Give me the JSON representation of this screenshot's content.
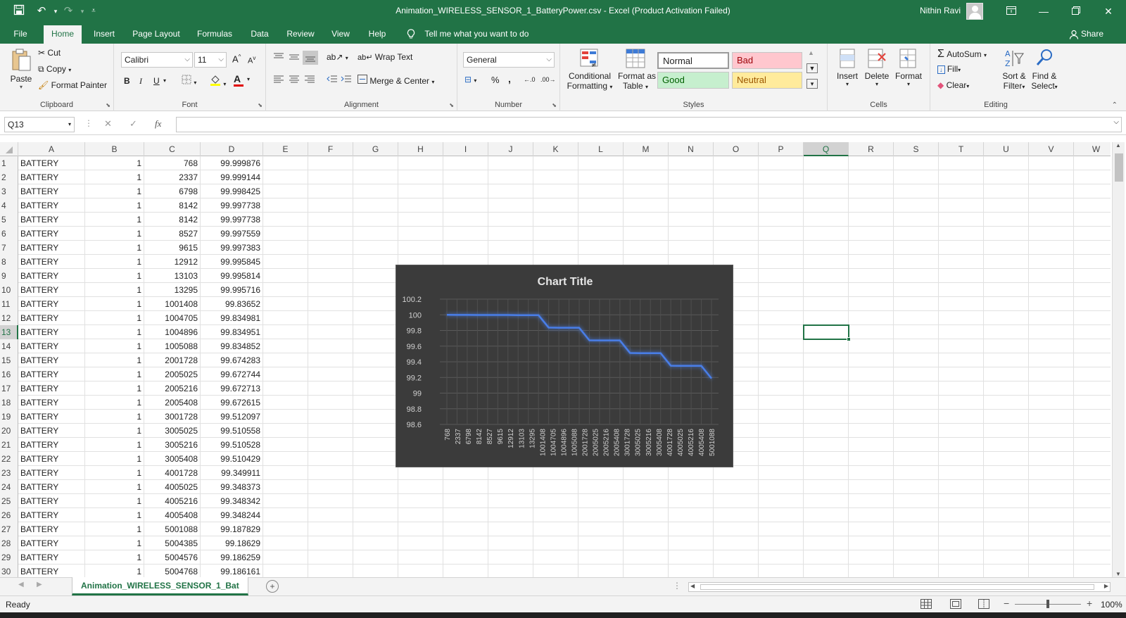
{
  "titlebar": {
    "title": "Animation_WIRELESS_SENSOR_1_BatteryPower.csv  -  Excel (Product Activation Failed)",
    "user": "Nithin Ravi"
  },
  "tabs": [
    "File",
    "Home",
    "Insert",
    "Page Layout",
    "Formulas",
    "Data",
    "Review",
    "View",
    "Help"
  ],
  "active_tab": "Home",
  "tell_me": "Tell me what you want to do",
  "share": "Share",
  "ribbon": {
    "clipboard": {
      "paste": "Paste",
      "cut": "Cut",
      "copy": "Copy",
      "format_painter": "Format Painter",
      "label": "Clipboard"
    },
    "font": {
      "name": "Calibri",
      "size": "11",
      "bold": "B",
      "italic": "I",
      "underline": "U",
      "label": "Font"
    },
    "alignment": {
      "wrap": "Wrap Text",
      "merge": "Merge & Center",
      "label": "Alignment"
    },
    "number": {
      "format": "General",
      "percent": "%",
      "comma": ",",
      "label": "Number"
    },
    "styles": {
      "conditional": [
        "Conditional",
        "Formatting"
      ],
      "format_table": [
        "Format as",
        "Table"
      ],
      "normal": "Normal",
      "bad": "Bad",
      "good": "Good",
      "neutral": "Neutral",
      "label": "Styles"
    },
    "cells": {
      "insert": "Insert",
      "delete": "Delete",
      "format": "Format",
      "label": "Cells"
    },
    "editing": {
      "autosum": "AutoSum",
      "fill": "Fill",
      "clear": "Clear",
      "sort": [
        "Sort &",
        "Filter"
      ],
      "find": [
        "Find &",
        "Select"
      ],
      "label": "Editing"
    }
  },
  "formula_bar": {
    "name_box": "Q13",
    "fx": "fx",
    "value": ""
  },
  "columns": [
    "A",
    "B",
    "C",
    "D",
    "E",
    "F",
    "G",
    "H",
    "I",
    "J",
    "K",
    "L",
    "M",
    "N",
    "O",
    "P",
    "Q",
    "R",
    "S",
    "T",
    "U",
    "V",
    "W"
  ],
  "selected_column": "Q",
  "selected_row": 13,
  "rows": [
    [
      "BATTERY",
      "1",
      "768",
      "99.999876"
    ],
    [
      "BATTERY",
      "1",
      "2337",
      "99.999144"
    ],
    [
      "BATTERY",
      "1",
      "6798",
      "99.998425"
    ],
    [
      "BATTERY",
      "1",
      "8142",
      "99.997738"
    ],
    [
      "BATTERY",
      "1",
      "8142",
      "99.997738"
    ],
    [
      "BATTERY",
      "1",
      "8527",
      "99.997559"
    ],
    [
      "BATTERY",
      "1",
      "9615",
      "99.997383"
    ],
    [
      "BATTERY",
      "1",
      "12912",
      "99.995845"
    ],
    [
      "BATTERY",
      "1",
      "13103",
      "99.995814"
    ],
    [
      "BATTERY",
      "1",
      "13295",
      "99.995716"
    ],
    [
      "BATTERY",
      "1",
      "1001408",
      "99.83652"
    ],
    [
      "BATTERY",
      "1",
      "1004705",
      "99.834981"
    ],
    [
      "BATTERY",
      "1",
      "1004896",
      "99.834951"
    ],
    [
      "BATTERY",
      "1",
      "1005088",
      "99.834852"
    ],
    [
      "BATTERY",
      "1",
      "2001728",
      "99.674283"
    ],
    [
      "BATTERY",
      "1",
      "2005025",
      "99.672744"
    ],
    [
      "BATTERY",
      "1",
      "2005216",
      "99.672713"
    ],
    [
      "BATTERY",
      "1",
      "2005408",
      "99.672615"
    ],
    [
      "BATTERY",
      "1",
      "3001728",
      "99.512097"
    ],
    [
      "BATTERY",
      "1",
      "3005025",
      "99.510558"
    ],
    [
      "BATTERY",
      "1",
      "3005216",
      "99.510528"
    ],
    [
      "BATTERY",
      "1",
      "3005408",
      "99.510429"
    ],
    [
      "BATTERY",
      "1",
      "4001728",
      "99.349911"
    ],
    [
      "BATTERY",
      "1",
      "4005025",
      "99.348373"
    ],
    [
      "BATTERY",
      "1",
      "4005216",
      "99.348342"
    ],
    [
      "BATTERY",
      "1",
      "4005408",
      "99.348244"
    ],
    [
      "BATTERY",
      "1",
      "5001088",
      "99.187829"
    ],
    [
      "BATTERY",
      "1",
      "5004385",
      "99.18629"
    ],
    [
      "BATTERY",
      "1",
      "5004576",
      "99.186259"
    ],
    [
      "BATTERY",
      "1",
      "5004768",
      "99.186161"
    ]
  ],
  "chart_data": {
    "type": "line",
    "title": "Chart Title",
    "categories": [
      "768",
      "2337",
      "6798",
      "8142",
      "8142",
      "8527",
      "9615",
      "12912",
      "13103",
      "13295",
      "1001408",
      "1004705",
      "1004896",
      "1005088",
      "2001728",
      "2005025",
      "2005216",
      "2005408",
      "3001728",
      "3005025",
      "3005216",
      "3005408",
      "4001728",
      "4005025",
      "4005216",
      "4005408",
      "5001088"
    ],
    "values": [
      99.999876,
      99.999144,
      99.998425,
      99.997738,
      99.997738,
      99.997559,
      99.997383,
      99.995845,
      99.995814,
      99.995716,
      99.83652,
      99.834981,
      99.834951,
      99.834852,
      99.674283,
      99.672744,
      99.672713,
      99.672615,
      99.512097,
      99.510558,
      99.510528,
      99.510429,
      99.349911,
      99.348373,
      99.348342,
      99.348244,
      99.187829
    ],
    "x_tick_labels": [
      "768",
      "2337",
      "6798",
      "8142",
      "8527",
      "9615",
      "12912",
      "13103",
      "13295",
      "1001408",
      "1004705",
      "1004896",
      "1005088",
      "2001728",
      "2005025",
      "2005216",
      "2005408",
      "3001728",
      "3005025",
      "3005216",
      "3005408",
      "4001728",
      "4005025",
      "4005216",
      "4005408",
      "5001088"
    ],
    "y_ticks": [
      "100.2",
      "100",
      "99.8",
      "99.6",
      "99.4",
      "99.2",
      "99",
      "98.8",
      "98.6"
    ],
    "ylim": [
      98.6,
      100.2
    ],
    "grid": true,
    "line_color": "#4a7ee8",
    "background": "#3b3b3b"
  },
  "sheet_tab": "Animation_WIRELESS_SENSOR_1_Bat",
  "status": {
    "ready": "Ready",
    "zoom": "100%"
  },
  "colors": {
    "excel_green": "#217346",
    "bad_bg": "#ffc7ce",
    "bad_fg": "#9c0006",
    "good_bg": "#c6efce",
    "good_fg": "#006100",
    "neutral_bg": "#ffeb9c",
    "neutral_fg": "#9c5700"
  }
}
